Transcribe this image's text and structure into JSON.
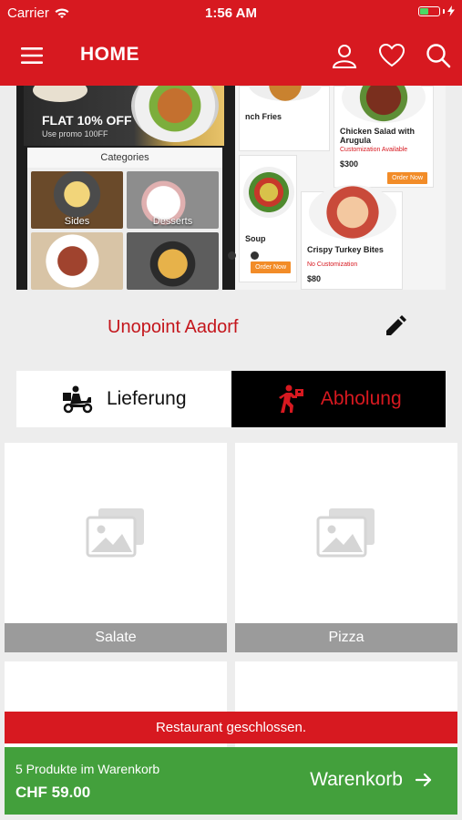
{
  "status_bar": {
    "carrier": "Carrier",
    "time": "1:56 AM"
  },
  "header": {
    "title": "HOME",
    "accent": "#d71920"
  },
  "banner": {
    "promo_title": "FLAT 10% OFF",
    "promo_sub": "Use promo 100FF",
    "categories_title": "Categories",
    "categories": [
      "Sides",
      "Desserts",
      "",
      ""
    ],
    "menu_cards": [
      {
        "name": "nch Fries",
        "custom": "",
        "price": "",
        "order": ""
      },
      {
        "name": "Chicken Salad with Arugula",
        "custom": "Customization Available",
        "price": "$300",
        "order": "Order Now"
      },
      {
        "name": "Soup",
        "custom": "",
        "price": "",
        "order": "Order Now"
      },
      {
        "name": "Crispy Turkey Bites",
        "custom": "No Customization",
        "price": "$80",
        "order": ""
      }
    ],
    "slide_count": 2,
    "active_slide": 1
  },
  "store": {
    "name": "Unopoint Aadorf"
  },
  "order_mode": {
    "delivery": "Lieferung",
    "pickup": "Abholung",
    "selected": "pickup"
  },
  "categories": [
    {
      "label": "Salate"
    },
    {
      "label": "Pizza"
    },
    {
      "label": ""
    },
    {
      "label": ""
    }
  ],
  "notice": {
    "text": "Restaurant geschlossen."
  },
  "cart": {
    "count_text": "5 Produkte im Warenkorb",
    "total": "CHF 59.00",
    "button": "Warenkorb"
  }
}
